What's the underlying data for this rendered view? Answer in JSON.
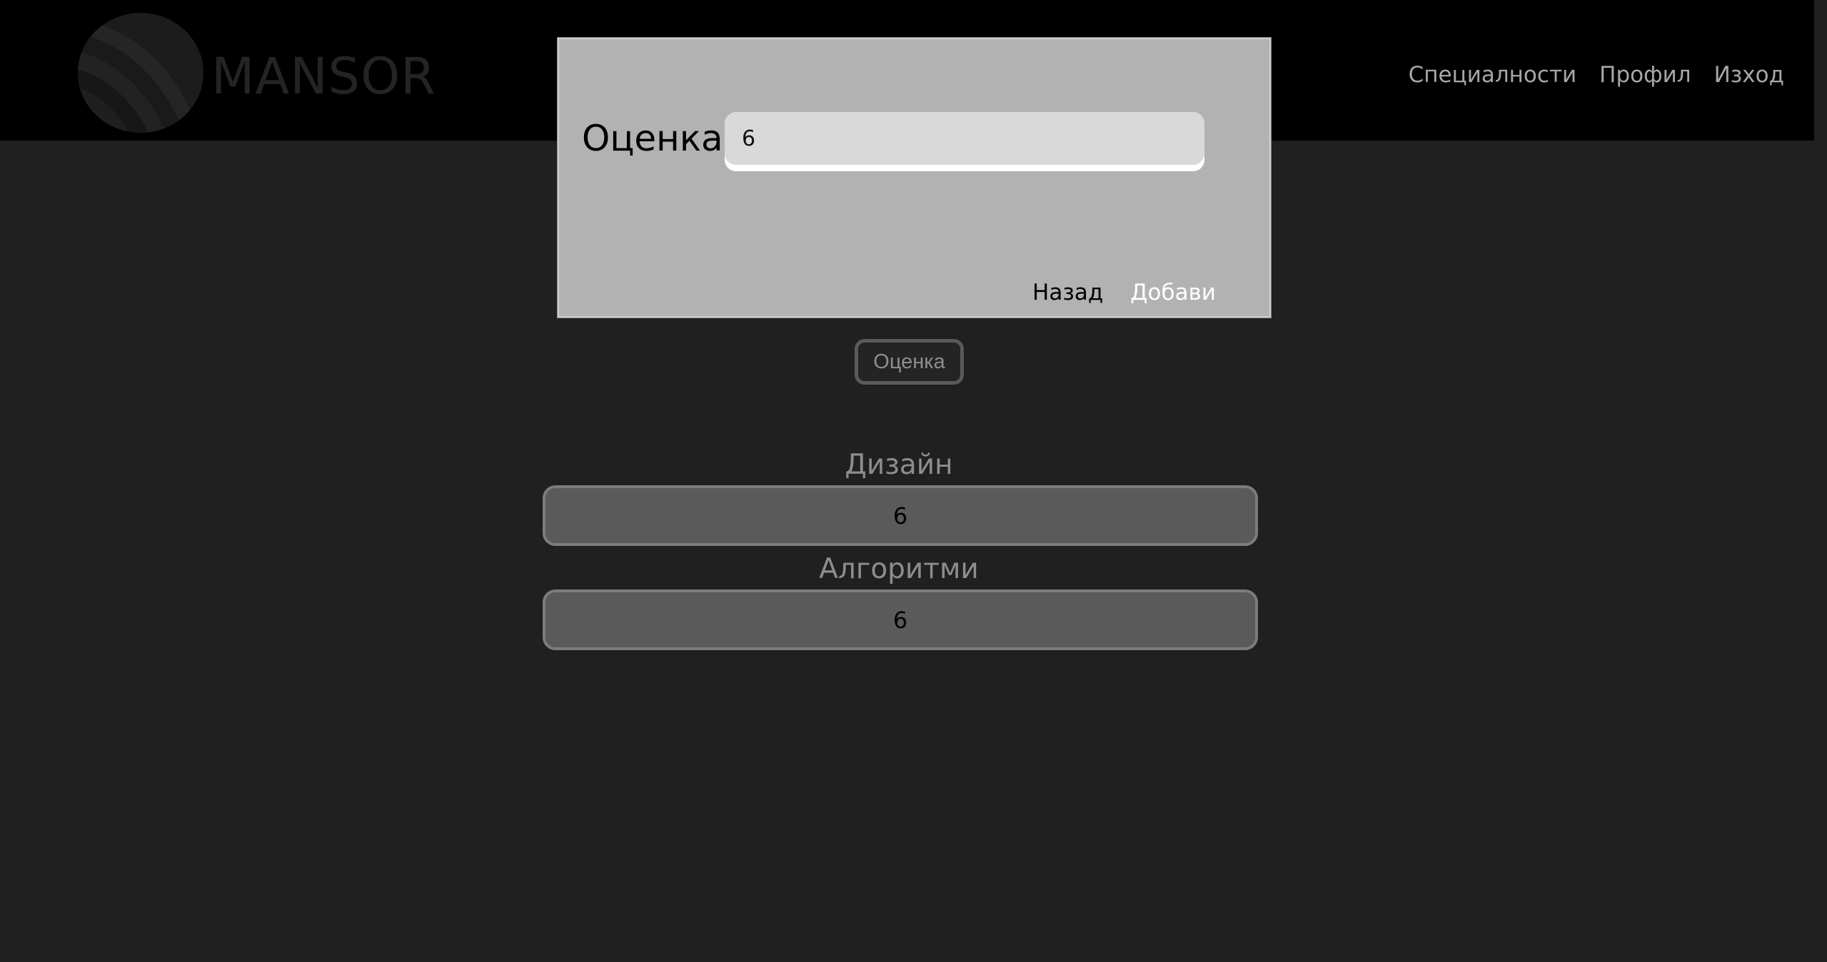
{
  "brand": {
    "name": "MANSOR"
  },
  "nav": {
    "items": [
      {
        "label": "Специалности"
      },
      {
        "label": "Профил"
      },
      {
        "label": "Изход"
      }
    ]
  },
  "main": {
    "grade_button_label": "Оценка",
    "subjects": [
      {
        "name": "Дизайн",
        "grade": "6"
      },
      {
        "name": "Алгоритми",
        "grade": "6"
      }
    ]
  },
  "modal": {
    "label": "Оценка:",
    "input_value": "6",
    "back_label": "Назад",
    "add_label": "Добави"
  },
  "colors": {
    "page_background": "#202020",
    "header_background": "#000000",
    "modal_background": "#b2b2b2",
    "subject_box": "#5a5a5a"
  }
}
